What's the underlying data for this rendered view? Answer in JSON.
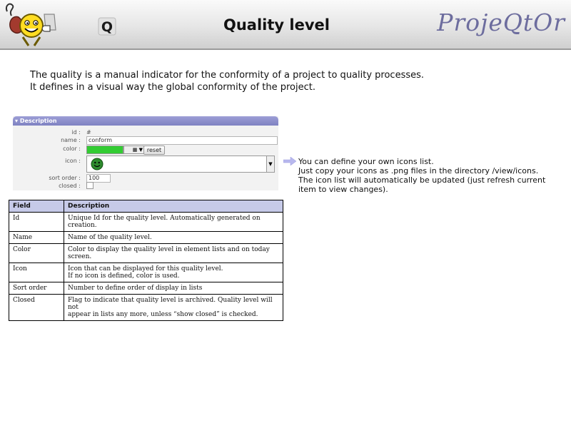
{
  "header": {
    "title": "Quality level",
    "brand": "ProjeQtOr",
    "badge_letter": "Q"
  },
  "intro": [
    "The quality is a manual indicator for the conformity of a project to quality processes.",
    "It defines in a visual way the global conformity of the project."
  ],
  "form": {
    "section_title": "Description",
    "id_label": "id :",
    "id_value": "# 1",
    "name_label": "name :",
    "name_value": "conform",
    "color_label": "color :",
    "color_value": "#33cc33",
    "reset_label": "reset",
    "icon_label": "icon :",
    "icon_name": "smiley-green-icon",
    "sort_order_label": "sort order :",
    "sort_order_value": "100",
    "closed_label": "closed :"
  },
  "note": [
    "You can define your own icons list.",
    "Just copy your icons as .png files in the directory /view/icons.",
    "The icon list will automatically be updated (just refresh current",
    "item to view changes)."
  ],
  "table": {
    "headers": [
      "Field",
      "Description"
    ],
    "rows": [
      {
        "field": "Id",
        "desc": [
          "Unique Id for the quality level. Automatically generated on",
          "creation."
        ]
      },
      {
        "field": "Name",
        "desc": [
          "Name of the quality level."
        ]
      },
      {
        "field": "Color",
        "desc": [
          "Color to display the quality level in element lists and on today",
          "screen."
        ]
      },
      {
        "field": "Icon",
        "desc": [
          "Icon that can be displayed for this quality level.",
          "If no icon is defined, color is used."
        ]
      },
      {
        "field": "Sort order",
        "desc": [
          "Number to define order of display in lists"
        ]
      },
      {
        "field": "Closed",
        "desc": [
          "Flag to indicate that quality level is archived. Quality level will not",
          "appear in lists any more, unless “show closed” is checked."
        ]
      }
    ]
  }
}
